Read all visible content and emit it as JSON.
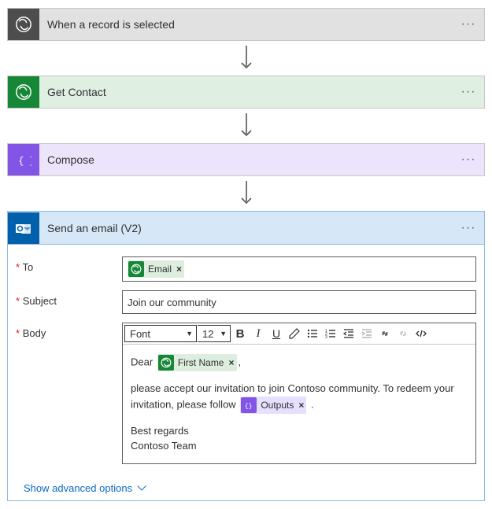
{
  "steps": {
    "trigger": {
      "title": "When a record is selected"
    },
    "getcontact": {
      "title": "Get Contact"
    },
    "compose": {
      "title": "Compose"
    },
    "email": {
      "title": "Send an email (V2)"
    }
  },
  "email": {
    "labels": {
      "to": "To",
      "subject": "Subject",
      "body": "Body"
    },
    "tokens": {
      "email": "Email",
      "firstname": "First Name",
      "outputs": "Outputs"
    },
    "subject_value": "Join our community",
    "body": {
      "greeting": "Dear",
      "comma": ",",
      "line1": "please accept our invitation to join Contoso community. To redeem your invitation, please follow",
      "period": ".",
      "signoff1": "Best regards",
      "signoff2": "Contoso Team"
    },
    "rte": {
      "font": "Font",
      "size": "12"
    }
  },
  "advanced": "Show advanced options"
}
